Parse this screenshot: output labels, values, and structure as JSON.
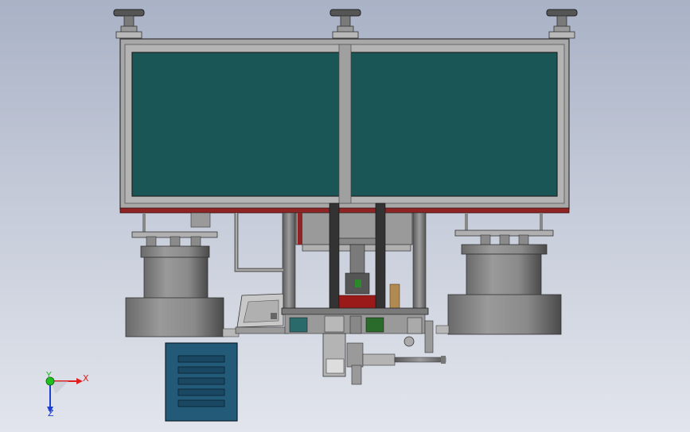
{
  "viewport": {
    "background_top": "#a9b2c6",
    "background_bottom": "#e2e5ec"
  },
  "colors": {
    "panel_glass": "#1a5656",
    "frame_gray": "#a8a8a8",
    "base_red": "#8e2424",
    "cabinet_blue": "#225a78",
    "axis_x": "#e02020",
    "axis_y": "#20c020",
    "axis_z": "#2040d0"
  },
  "triad": {
    "x_label": "X",
    "y_label": "Y",
    "z_label": "Z"
  }
}
